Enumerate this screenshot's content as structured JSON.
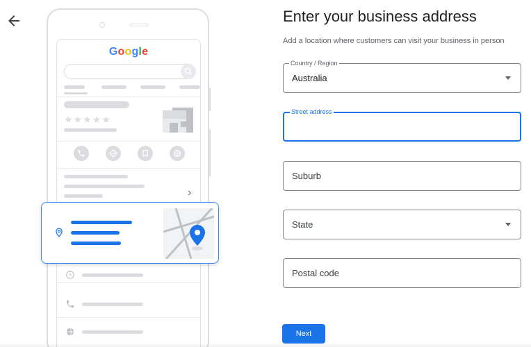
{
  "nav": {
    "back_icon": "arrow-back-icon"
  },
  "illustration": {
    "google_logo_letters": [
      "G",
      "o",
      "o",
      "g",
      "l",
      "e"
    ],
    "colors": {
      "blue": "#4285f4",
      "red": "#ea4335",
      "yellow": "#fbbc05",
      "green": "#34a853",
      "pin": "#1a73e8"
    },
    "stars": "★★★★★",
    "action_icons": [
      "phone-icon",
      "directions-icon",
      "bookmark-icon",
      "globe-icon"
    ],
    "chevron": "›",
    "list_icons": [
      "clock-icon",
      "phone-icon",
      "globe-icon"
    ]
  },
  "form": {
    "title": "Enter your business address",
    "subtitle": "Add a location where customers can visit your business in person",
    "country": {
      "label": "Country / Region",
      "value": "Australia"
    },
    "street": {
      "label": "Street address",
      "value": ""
    },
    "suburb": {
      "placeholder": "Suburb"
    },
    "state": {
      "placeholder": "State"
    },
    "postal": {
      "placeholder": "Postal code"
    },
    "next_label": "Next",
    "accent_color": "#1a73e8"
  }
}
